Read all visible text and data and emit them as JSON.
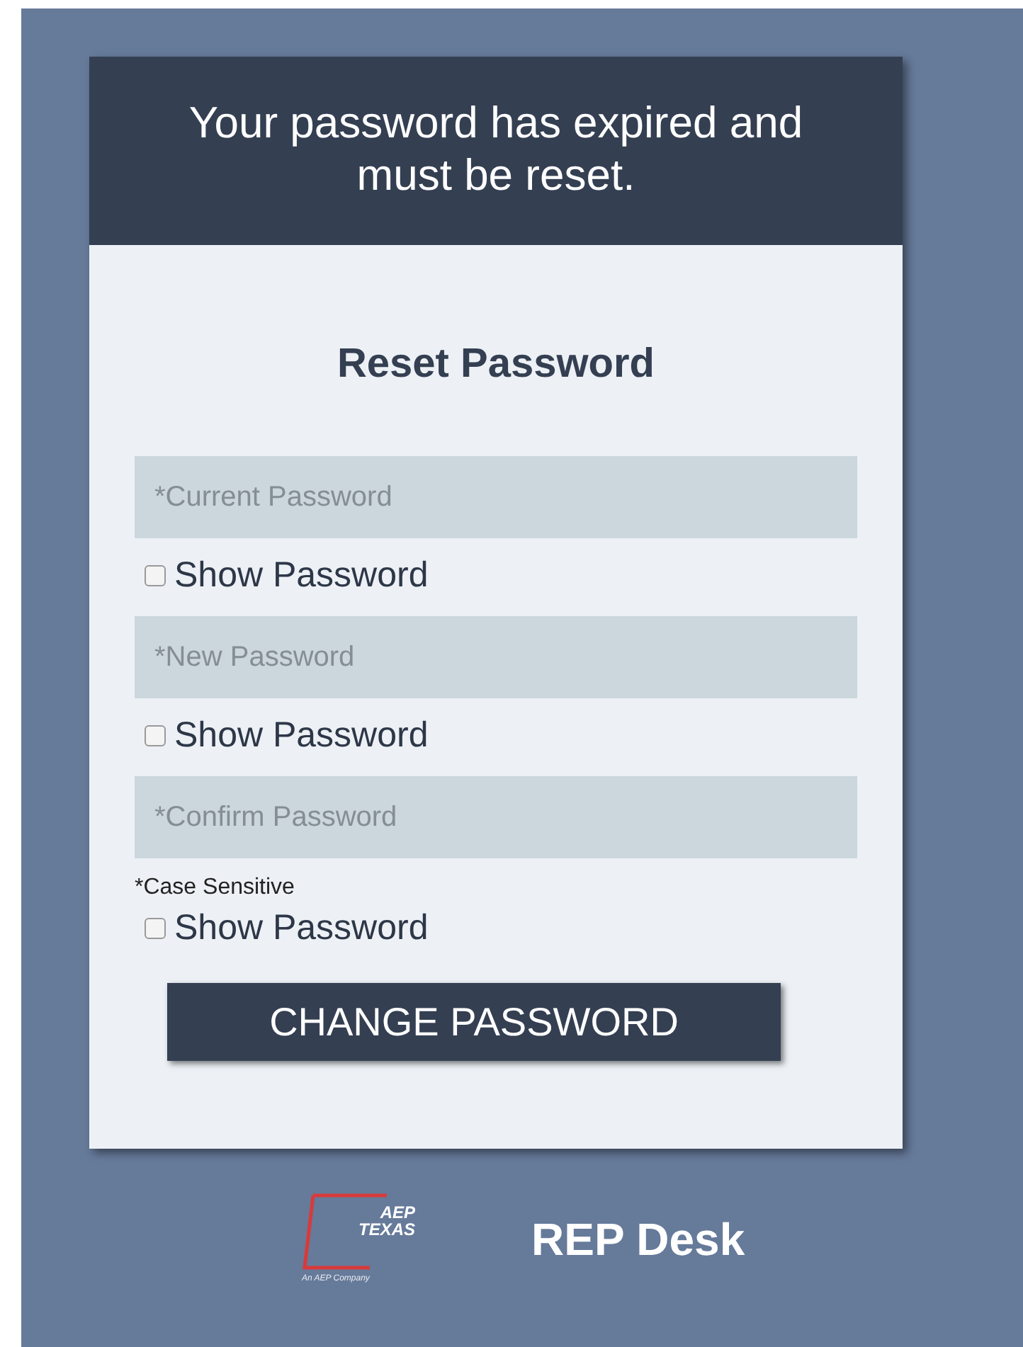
{
  "header": {
    "message": "Your password has expired and must be reset."
  },
  "form": {
    "title": "Reset Password",
    "fields": [
      {
        "placeholder": "*Current Password",
        "show_password": {
          "label": "Show Password",
          "checked": false
        }
      },
      {
        "placeholder": "*New Password",
        "show_password": {
          "label": "Show Password",
          "checked": false
        }
      },
      {
        "placeholder": "*Confirm Password",
        "note": "*Case Sensitive",
        "show_password": {
          "label": "Show Password",
          "checked": false
        }
      }
    ],
    "button": "CHANGE PASSWORD"
  },
  "footer": {
    "logo": {
      "line_1": "AEP",
      "line_2": "TEXAS",
      "tagline": "An AEP Company"
    },
    "app_name": "REP Desk"
  }
}
